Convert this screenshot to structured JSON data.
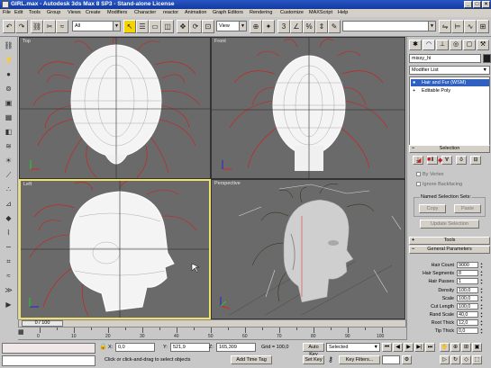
{
  "window": {
    "title": "GIRL.max - Autodesk 3ds Max 8 SP3 - Stand-alone License",
    "min": "_",
    "max": "□",
    "close": "×"
  },
  "menu": [
    "File",
    "Edit",
    "Tools",
    "Group",
    "Views",
    "Create",
    "Modifiers",
    "Character",
    "reactor",
    "Animation",
    "Graph Editors",
    "Rendering",
    "Customize",
    "MAXScript",
    "Help"
  ],
  "toolbar": {
    "selection_filter": "All",
    "ref_coord": "View",
    "named_selection": ""
  },
  "viewports": {
    "top": "Top",
    "front": "Front",
    "left": "Left",
    "perspective": "Perspective"
  },
  "command_panel": {
    "object_name": "missy_hi",
    "modifier_list": "Modifier List",
    "stack": [
      "Hair and Fur (WSM)",
      "Editable Poly"
    ],
    "selection": {
      "title": "Selection",
      "by_vertex": "By Vertex",
      "ignore_backfacing": "Ignore Backfacing",
      "named_sel_sets": "Named Selection Sets:",
      "copy": "Copy",
      "paste": "Paste",
      "update_selection": "Update Selection"
    },
    "tools_title": "Tools",
    "general_params_title": "General Parameters",
    "params": [
      {
        "label": "Hair Count",
        "value": "9000"
      },
      {
        "label": "Hair Segments",
        "value": "8"
      },
      {
        "label": "Hair Passes",
        "value": "1"
      },
      {
        "label": "Density",
        "value": "100,0"
      },
      {
        "label": "Scale",
        "value": "100,0"
      },
      {
        "label": "Cut Length",
        "value": "100,0"
      },
      {
        "label": "Rand Scale",
        "value": "40,0"
      },
      {
        "label": "Root Thick",
        "value": "12,0"
      },
      {
        "label": "Tip Thick",
        "value": "0,0"
      }
    ]
  },
  "timeline": {
    "slider": "0 / 100",
    "ticks": [
      "0",
      "10",
      "20",
      "30",
      "40",
      "50",
      "60",
      "70",
      "80",
      "90",
      "100"
    ]
  },
  "status": {
    "prompt": "Click or click-and-drag to select objects",
    "x_label": "X:",
    "x": "0,0",
    "y_label": "Y:",
    "y": "521,9",
    "z_label": "Z:",
    "z": "165,309",
    "grid": "Grid = 100,0",
    "add_time_tag": "Add Time Tag",
    "auto_key": "Auto Key",
    "set_key": "Set Key",
    "key_mode": "Selected",
    "key_filters": "Key Filters..."
  }
}
